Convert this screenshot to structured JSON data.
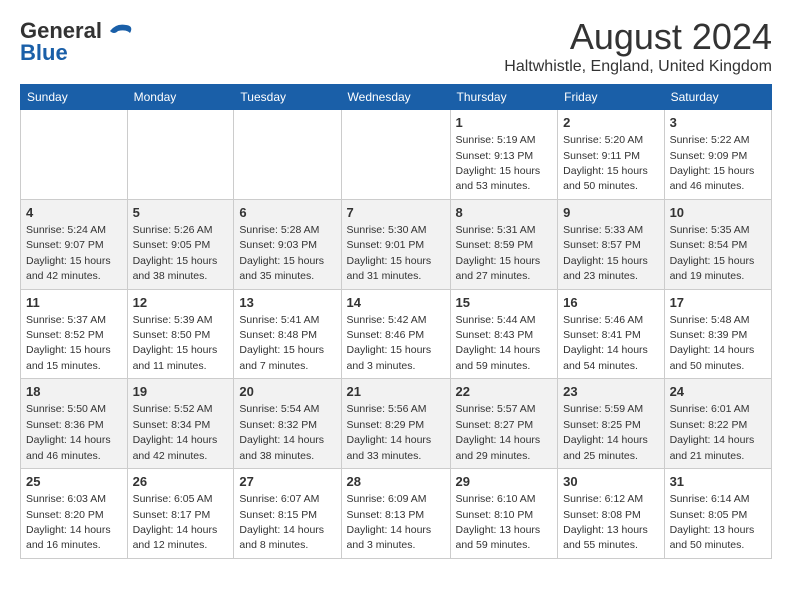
{
  "logo": {
    "part1": "General",
    "part2": "Blue"
  },
  "title": "August 2024",
  "subtitle": "Haltwhistle, England, United Kingdom",
  "days_of_week": [
    "Sunday",
    "Monday",
    "Tuesday",
    "Wednesday",
    "Thursday",
    "Friday",
    "Saturday"
  ],
  "weeks": [
    [
      {
        "day": "",
        "info": ""
      },
      {
        "day": "",
        "info": ""
      },
      {
        "day": "",
        "info": ""
      },
      {
        "day": "",
        "info": ""
      },
      {
        "day": "1",
        "info": "Sunrise: 5:19 AM\nSunset: 9:13 PM\nDaylight: 15 hours\nand 53 minutes."
      },
      {
        "day": "2",
        "info": "Sunrise: 5:20 AM\nSunset: 9:11 PM\nDaylight: 15 hours\nand 50 minutes."
      },
      {
        "day": "3",
        "info": "Sunrise: 5:22 AM\nSunset: 9:09 PM\nDaylight: 15 hours\nand 46 minutes."
      }
    ],
    [
      {
        "day": "4",
        "info": "Sunrise: 5:24 AM\nSunset: 9:07 PM\nDaylight: 15 hours\nand 42 minutes."
      },
      {
        "day": "5",
        "info": "Sunrise: 5:26 AM\nSunset: 9:05 PM\nDaylight: 15 hours\nand 38 minutes."
      },
      {
        "day": "6",
        "info": "Sunrise: 5:28 AM\nSunset: 9:03 PM\nDaylight: 15 hours\nand 35 minutes."
      },
      {
        "day": "7",
        "info": "Sunrise: 5:30 AM\nSunset: 9:01 PM\nDaylight: 15 hours\nand 31 minutes."
      },
      {
        "day": "8",
        "info": "Sunrise: 5:31 AM\nSunset: 8:59 PM\nDaylight: 15 hours\nand 27 minutes."
      },
      {
        "day": "9",
        "info": "Sunrise: 5:33 AM\nSunset: 8:57 PM\nDaylight: 15 hours\nand 23 minutes."
      },
      {
        "day": "10",
        "info": "Sunrise: 5:35 AM\nSunset: 8:54 PM\nDaylight: 15 hours\nand 19 minutes."
      }
    ],
    [
      {
        "day": "11",
        "info": "Sunrise: 5:37 AM\nSunset: 8:52 PM\nDaylight: 15 hours\nand 15 minutes."
      },
      {
        "day": "12",
        "info": "Sunrise: 5:39 AM\nSunset: 8:50 PM\nDaylight: 15 hours\nand 11 minutes."
      },
      {
        "day": "13",
        "info": "Sunrise: 5:41 AM\nSunset: 8:48 PM\nDaylight: 15 hours\nand 7 minutes."
      },
      {
        "day": "14",
        "info": "Sunrise: 5:42 AM\nSunset: 8:46 PM\nDaylight: 15 hours\nand 3 minutes."
      },
      {
        "day": "15",
        "info": "Sunrise: 5:44 AM\nSunset: 8:43 PM\nDaylight: 14 hours\nand 59 minutes."
      },
      {
        "day": "16",
        "info": "Sunrise: 5:46 AM\nSunset: 8:41 PM\nDaylight: 14 hours\nand 54 minutes."
      },
      {
        "day": "17",
        "info": "Sunrise: 5:48 AM\nSunset: 8:39 PM\nDaylight: 14 hours\nand 50 minutes."
      }
    ],
    [
      {
        "day": "18",
        "info": "Sunrise: 5:50 AM\nSunset: 8:36 PM\nDaylight: 14 hours\nand 46 minutes."
      },
      {
        "day": "19",
        "info": "Sunrise: 5:52 AM\nSunset: 8:34 PM\nDaylight: 14 hours\nand 42 minutes."
      },
      {
        "day": "20",
        "info": "Sunrise: 5:54 AM\nSunset: 8:32 PM\nDaylight: 14 hours\nand 38 minutes."
      },
      {
        "day": "21",
        "info": "Sunrise: 5:56 AM\nSunset: 8:29 PM\nDaylight: 14 hours\nand 33 minutes."
      },
      {
        "day": "22",
        "info": "Sunrise: 5:57 AM\nSunset: 8:27 PM\nDaylight: 14 hours\nand 29 minutes."
      },
      {
        "day": "23",
        "info": "Sunrise: 5:59 AM\nSunset: 8:25 PM\nDaylight: 14 hours\nand 25 minutes."
      },
      {
        "day": "24",
        "info": "Sunrise: 6:01 AM\nSunset: 8:22 PM\nDaylight: 14 hours\nand 21 minutes."
      }
    ],
    [
      {
        "day": "25",
        "info": "Sunrise: 6:03 AM\nSunset: 8:20 PM\nDaylight: 14 hours\nand 16 minutes."
      },
      {
        "day": "26",
        "info": "Sunrise: 6:05 AM\nSunset: 8:17 PM\nDaylight: 14 hours\nand 12 minutes."
      },
      {
        "day": "27",
        "info": "Sunrise: 6:07 AM\nSunset: 8:15 PM\nDaylight: 14 hours\nand 8 minutes."
      },
      {
        "day": "28",
        "info": "Sunrise: 6:09 AM\nSunset: 8:13 PM\nDaylight: 14 hours\nand 3 minutes."
      },
      {
        "day": "29",
        "info": "Sunrise: 6:10 AM\nSunset: 8:10 PM\nDaylight: 13 hours\nand 59 minutes."
      },
      {
        "day": "30",
        "info": "Sunrise: 6:12 AM\nSunset: 8:08 PM\nDaylight: 13 hours\nand 55 minutes."
      },
      {
        "day": "31",
        "info": "Sunrise: 6:14 AM\nSunset: 8:05 PM\nDaylight: 13 hours\nand 50 minutes."
      }
    ]
  ]
}
